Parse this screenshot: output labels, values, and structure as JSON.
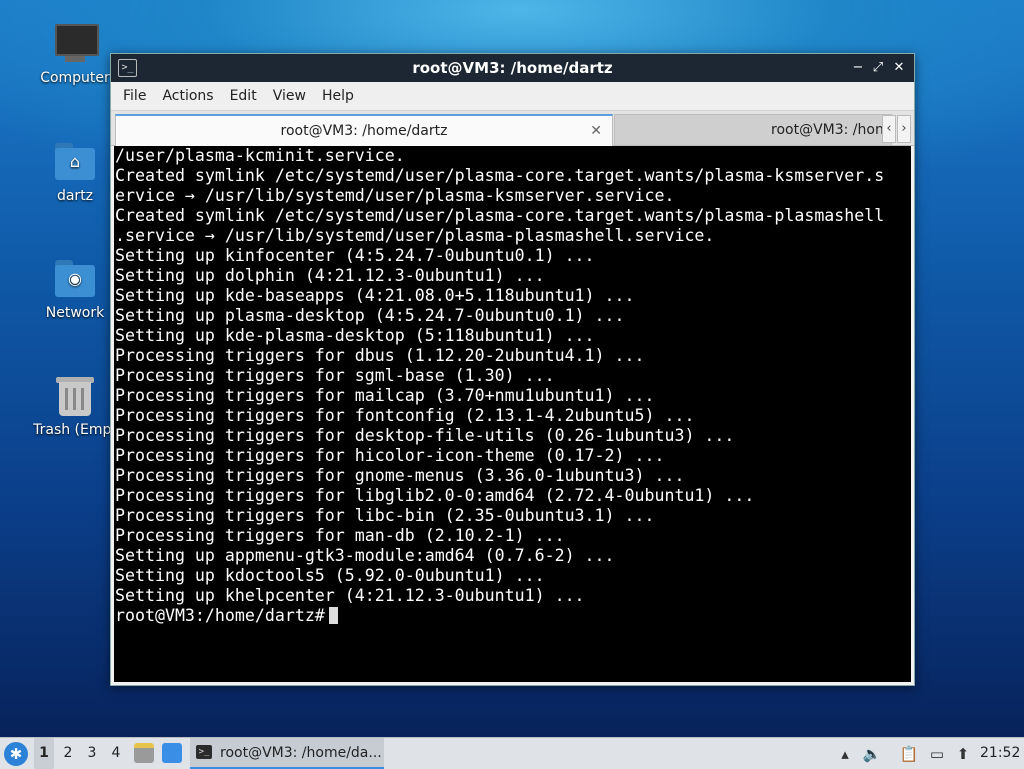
{
  "desktop": {
    "icons": [
      {
        "label": "Computer"
      },
      {
        "label": "dartz"
      },
      {
        "label": "Network"
      },
      {
        "label": "Trash (Empt"
      }
    ]
  },
  "window": {
    "title": "root@VM3: /home/dartz",
    "menu": [
      "File",
      "Actions",
      "Edit",
      "View",
      "Help"
    ],
    "tabs": [
      {
        "label": "root@VM3: /home/dartz",
        "close": "✕"
      },
      {
        "label": "root@VM3: /hon"
      }
    ],
    "controls": {
      "minimize": "−",
      "maximize": "⤢",
      "close": "✕",
      "scroll_left": "‹",
      "scroll_right": "›"
    }
  },
  "terminal": {
    "lines": [
      "/user/plasma-kcminit.service.",
      "Created symlink /etc/systemd/user/plasma-core.target.wants/plasma-ksmserver.s",
      "ervice → /usr/lib/systemd/user/plasma-ksmserver.service.",
      "Created symlink /etc/systemd/user/plasma-core.target.wants/plasma-plasmashell",
      ".service → /usr/lib/systemd/user/plasma-plasmashell.service.",
      "Setting up kinfocenter (4:5.24.7-0ubuntu0.1) ...",
      "Setting up dolphin (4:21.12.3-0ubuntu1) ...",
      "Setting up kde-baseapps (4:21.08.0+5.118ubuntu1) ...",
      "Setting up plasma-desktop (4:5.24.7-0ubuntu0.1) ...",
      "Setting up kde-plasma-desktop (5:118ubuntu1) ...",
      "Processing triggers for dbus (1.12.20-2ubuntu4.1) ...",
      "Processing triggers for sgml-base (1.30) ...",
      "Processing triggers for mailcap (3.70+nmu1ubuntu1) ...",
      "Processing triggers for fontconfig (2.13.1-4.2ubuntu5) ...",
      "Processing triggers for desktop-file-utils (0.26-1ubuntu3) ...",
      "Processing triggers for hicolor-icon-theme (0.17-2) ...",
      "Processing triggers for gnome-menus (3.36.0-1ubuntu3) ...",
      "Processing triggers for libglib2.0-0:amd64 (2.72.4-0ubuntu1) ...",
      "Processing triggers for libc-bin (2.35-0ubuntu3.1) ...",
      "Processing triggers for man-db (2.10.2-1) ...",
      "Setting up appmenu-gtk3-module:amd64 (0.7.6-2) ...",
      "Setting up kdoctools5 (5.92.0-0ubuntu1) ...",
      "Setting up khelpcenter (4:21.12.3-0ubuntu1) ..."
    ],
    "prompt": "root@VM3:/home/dartz#"
  },
  "taskbar": {
    "workspaces": [
      "1",
      "2",
      "3",
      "4"
    ],
    "task_label": "root@VM3: /home/da...",
    "clock": "21:52",
    "accent": "#3a8ee6"
  }
}
